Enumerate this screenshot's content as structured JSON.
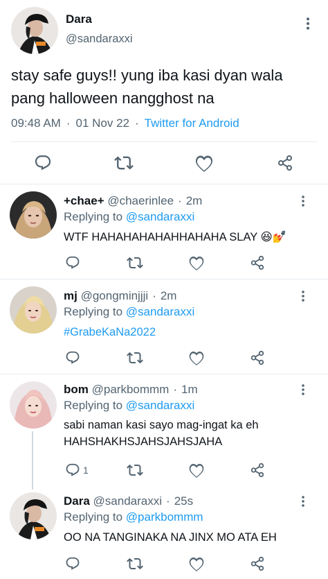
{
  "main_tweet": {
    "name": "Dara",
    "handle": "@sandaraxxi",
    "text": "stay safe guys!! yung iba kasi dyan wala pang halloween nangghost na",
    "time": "09:48 AM",
    "dot": "·",
    "date": "01 Nov 22",
    "source": "Twitter for Android"
  },
  "replies": [
    {
      "name": "+chae+",
      "handle": "@chaerinlee",
      "sep": "·",
      "time": "2m",
      "replying_label": "Replying to",
      "replying_to": "@sandaraxxi",
      "text": "WTF HAHAHAHAHAHHAHAHA SLAY 😆💅",
      "reply_count": ""
    },
    {
      "name": "mj",
      "handle": "@gongminjjji",
      "sep": "·",
      "time": "2m",
      "replying_label": "Replying to",
      "replying_to": "@sandaraxxi",
      "text": "#GrabeKaNa2022",
      "reply_count": ""
    },
    {
      "name": "bom",
      "handle": "@parkbommm",
      "sep": "·",
      "time": "1m",
      "replying_label": "Replying to",
      "replying_to": "@sandaraxxi",
      "text": "sabi naman kasi sayo mag-ingat ka eh HAHSHAKHSJAHSJAHSJAHA",
      "reply_count": "1"
    },
    {
      "name": "Dara",
      "handle": "@sandaraxxi",
      "sep": "·",
      "time": "25s",
      "replying_label": "Replying to",
      "replying_to": "@parkbommm",
      "text": "OO NA TANGINAKA NA JINX MO ATA EH",
      "reply_count": ""
    }
  ],
  "icons": {
    "reply": "reply-icon",
    "retweet": "retweet-icon",
    "like": "heart-icon",
    "share": "share-icon",
    "more": "more-vertical-icon"
  },
  "colors": {
    "link": "#1d9bf0",
    "secondary_text": "#536471",
    "divider": "#e6ecf0"
  }
}
